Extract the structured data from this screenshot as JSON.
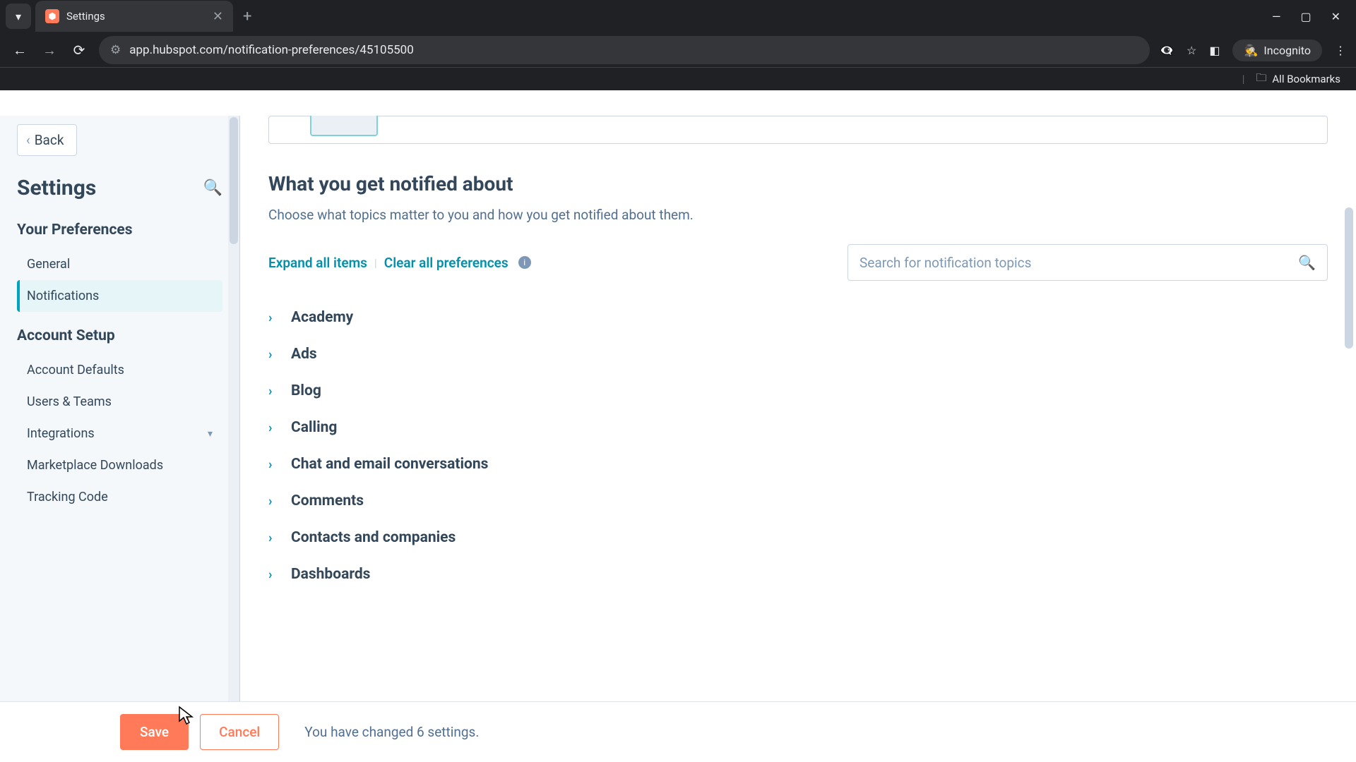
{
  "browser": {
    "tab_title": "Settings",
    "url": "app.hubspot.com/notification-preferences/45105500",
    "incognito_label": "Incognito",
    "all_bookmarks": "All Bookmarks"
  },
  "sidebar": {
    "back_label": "Back",
    "title": "Settings",
    "sections": {
      "prefs_head": "Your Preferences",
      "prefs_items": [
        "General",
        "Notifications"
      ],
      "account_head": "Account Setup",
      "account_items": [
        "Account Defaults",
        "Users & Teams",
        "Integrations",
        "Marketplace Downloads",
        "Tracking Code"
      ]
    }
  },
  "main": {
    "heading": "What you get notified about",
    "subtext": "Choose what topics matter to you and how you get notified about them.",
    "expand_label": "Expand all items",
    "clear_label": "Clear all preferences",
    "search_placeholder": "Search for notification topics",
    "topics": [
      "Academy",
      "Ads",
      "Blog",
      "Calling",
      "Chat and email conversations",
      "Comments",
      "Contacts and companies",
      "Dashboards"
    ]
  },
  "footer": {
    "save": "Save",
    "cancel": "Cancel",
    "changed": "You have changed 6 settings."
  }
}
